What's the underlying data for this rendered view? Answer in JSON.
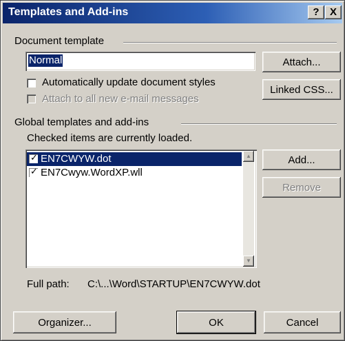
{
  "window": {
    "title": "Templates and Add-ins",
    "help_label": "?",
    "close_label": "X"
  },
  "document_template": {
    "group_label": "Document template",
    "template_value": "Normal",
    "attach_label": "Attach...",
    "auto_update_label": "Automatically update document styles",
    "attach_email_label": "Attach to all new e-mail messages",
    "linked_css_label": "Linked CSS..."
  },
  "global_templates": {
    "group_label": "Global templates and add-ins",
    "hint": "Checked items are currently loaded.",
    "items": [
      {
        "label": "EN7CWYW.dot",
        "checked": true,
        "selected": true
      },
      {
        "label": "EN7Cwyw.WordXP.wll",
        "checked": true,
        "selected": false
      }
    ],
    "add_label": "Add...",
    "remove_label": "Remove",
    "full_path_label": "Full path:",
    "full_path_value": "C:\\...\\Word\\STARTUP\\EN7CWYW.dot"
  },
  "footer": {
    "organizer_label": "Organizer...",
    "ok_label": "OK",
    "cancel_label": "Cancel"
  }
}
